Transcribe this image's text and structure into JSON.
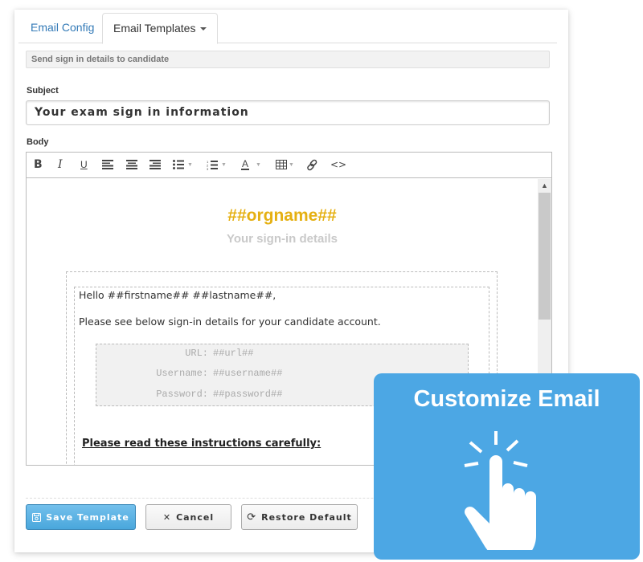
{
  "tabs": [
    {
      "label": "Email Config",
      "active": false
    },
    {
      "label": "Email Templates",
      "active": true,
      "has_dropdown": true
    }
  ],
  "template_select": {
    "value": "Send sign in details to candidate"
  },
  "subject": {
    "label": "Subject",
    "value": "Your exam sign in information"
  },
  "body": {
    "label": "Body",
    "toolbar": [
      {
        "icon": "bold-icon"
      },
      {
        "icon": "italic-icon"
      },
      {
        "icon": "underline-icon"
      },
      {
        "icon": "align-left-icon"
      },
      {
        "icon": "align-center-icon"
      },
      {
        "icon": "align-right-icon"
      },
      {
        "icon": "bullet-list-icon",
        "dropdown": true
      },
      {
        "icon": "numbered-list-icon",
        "dropdown": true
      },
      {
        "icon": "text-color-icon",
        "dropdown": true
      },
      {
        "icon": "table-icon",
        "dropdown": true
      },
      {
        "icon": "link-icon"
      },
      {
        "icon": "code-view-icon"
      }
    ],
    "content": {
      "orgname": "##orgname##",
      "subtitle": "Your sign-in details",
      "greeting": "Hello ##firstname## ##lastname##,",
      "intro": "Please see below sign-in details for your candidate account.",
      "credentials": [
        {
          "key": "URL:",
          "value": "##url##"
        },
        {
          "key": "Username:",
          "value": "##username##"
        },
        {
          "key": "Password:",
          "value": "##password##"
        }
      ],
      "instructions_heading": "Please read these instructions carefully:"
    }
  },
  "buttons": {
    "save": "Save Template",
    "cancel": "Cancel",
    "restore": "Restore Default"
  },
  "promo": {
    "title": "Customize Email",
    "icon": "tap-hand-icon"
  },
  "colors": {
    "link": "#337ab7",
    "orgname": "#e5b012",
    "primary_button": "#4aa7dc",
    "promo_bg": "#4ca7e4"
  }
}
